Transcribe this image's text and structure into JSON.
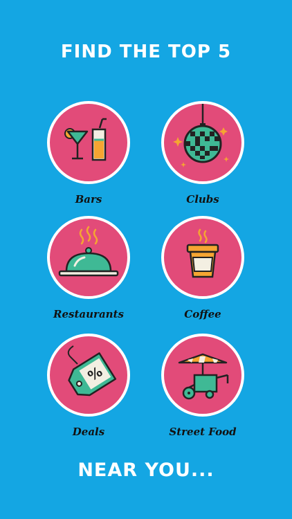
{
  "header": {
    "title": "FIND THE TOP 5"
  },
  "footer": {
    "title": "NEAR YOU..."
  },
  "colors": {
    "background": "#14a6e3",
    "circle": "#e24b79",
    "circle_border": "#ffffff",
    "icon_green": "#3fb995",
    "icon_dark": "#222222",
    "icon_light": "#f3efe2",
    "icon_orange": "#f5a532"
  },
  "categories": [
    {
      "label": "Bars",
      "icon": "cocktail-icon"
    },
    {
      "label": "Clubs",
      "icon": "disco-ball-icon"
    },
    {
      "label": "Restaurants",
      "icon": "cloche-icon"
    },
    {
      "label": "Coffee",
      "icon": "coffee-cup-icon"
    },
    {
      "label": "Deals",
      "icon": "discount-tag-icon"
    },
    {
      "label": "Street Food",
      "icon": "food-cart-icon"
    }
  ]
}
